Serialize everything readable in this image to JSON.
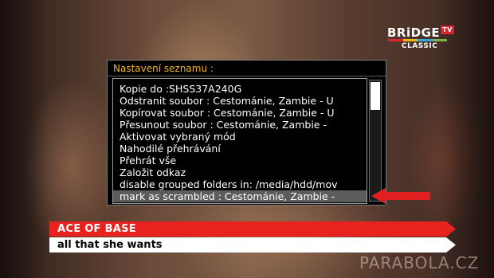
{
  "channel_logo": {
    "name": "BRiDGE",
    "badge": "TV",
    "sub": "CLASSIC",
    "stripe_colors": [
      "#e5232d",
      "#f2b21a",
      "#37a5dc",
      "#7ab648"
    ]
  },
  "dialog": {
    "title": "Nastavení seznamu :",
    "items": [
      {
        "label": "Kopie do :SHSS37A240G"
      },
      {
        "label": "Odstranit soubor :  Cestománie, Zambie - U"
      },
      {
        "label": "Kopírovat soubor :  Cestománie, Zambie - U"
      },
      {
        "label": "Přesunout soubor :  Cestománie, Zambie -"
      },
      {
        "label": "Aktivovat vybraný mód"
      },
      {
        "label": "Nahodilé přehrávání"
      },
      {
        "label": "Přehrát vše"
      },
      {
        "label": "Založit odkaz"
      },
      {
        "label": "disable grouped folders in: /media/hdd/mov"
      },
      {
        "label": "mark as scrambled : Cestománie, Zambie -"
      }
    ],
    "selected_index": 9
  },
  "lower_third": {
    "artist": "ACE OF BASE",
    "song": "all that she wants"
  },
  "watermark": "PARABOLA.CZ",
  "colors": {
    "title_accent": "#f3b327",
    "arrow": "#e0201e",
    "bar_red": "#e8231f",
    "bar_white": "#ffffff"
  }
}
